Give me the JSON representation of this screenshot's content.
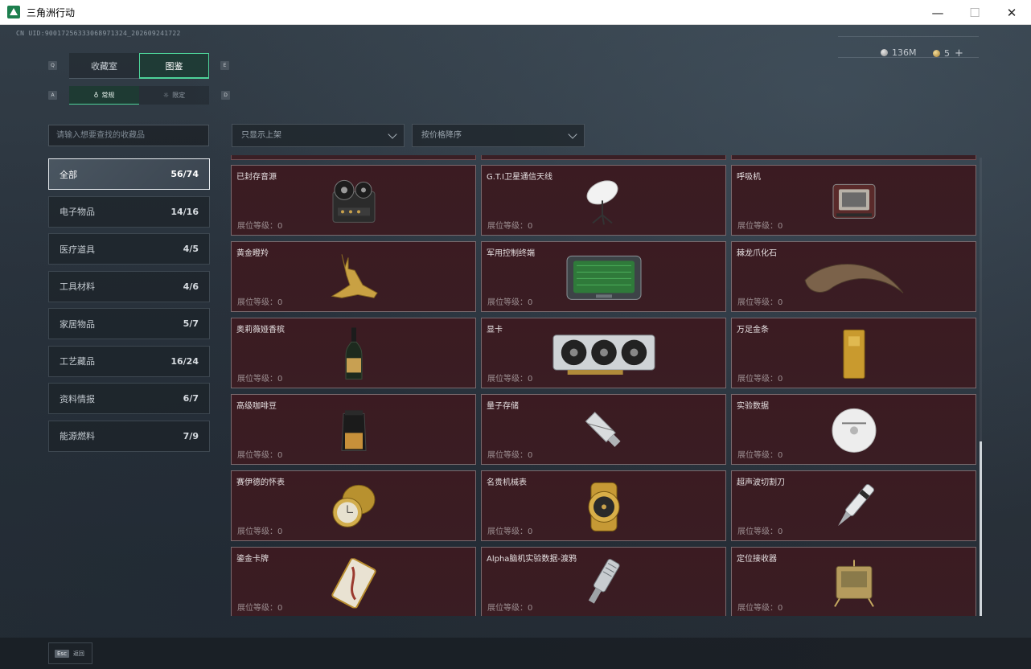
{
  "window": {
    "title": "三角洲行动",
    "minimize": "—",
    "maximize": "☐",
    "close": "✕"
  },
  "uid": "CN UID:9001725633306897132​4_2026092417​22",
  "currency": {
    "silver": "136M",
    "gold": "5",
    "plus": "+"
  },
  "keys": {
    "prev_tab": "Q",
    "next_tab": "E",
    "prev_sub": "A",
    "next_sub": "D"
  },
  "tabs": [
    {
      "label": "收藏室"
    },
    {
      "label": "图鉴"
    }
  ],
  "subtabs": [
    {
      "label": "常规"
    },
    {
      "label": "限定"
    }
  ],
  "search": {
    "placeholder": "请输入想要查找的收藏品"
  },
  "filters": {
    "shelf": "只显示上架",
    "sort": "按价格降序"
  },
  "categories": [
    {
      "label": "全部",
      "count": "56/74"
    },
    {
      "label": "电子物品",
      "count": "14/16"
    },
    {
      "label": "医疗道具",
      "count": "4/5"
    },
    {
      "label": "工具材料",
      "count": "4/6"
    },
    {
      "label": "家居物品",
      "count": "5/7"
    },
    {
      "label": "工艺藏品",
      "count": "16/24"
    },
    {
      "label": "资料情报",
      "count": "6/7"
    },
    {
      "label": "能源燃料",
      "count": "7/9"
    }
  ],
  "level_label": "展位等级：0",
  "items": [
    {
      "name": "已封存音源",
      "icon": "tape-recorder-icon"
    },
    {
      "name": "G.T.I卫星通信天线",
      "icon": "satellite-dish-icon"
    },
    {
      "name": "呼吸机",
      "icon": "ventilator-icon"
    },
    {
      "name": "黄金瞪羚",
      "icon": "golden-gazelle-icon"
    },
    {
      "name": "军用控制终端",
      "icon": "control-terminal-icon"
    },
    {
      "name": "棘龙爪化石",
      "icon": "claw-fossil-icon"
    },
    {
      "name": "奥莉薇娅香槟",
      "icon": "champagne-icon"
    },
    {
      "name": "显卡",
      "icon": "graphics-card-icon"
    },
    {
      "name": "万足金条",
      "icon": "gold-bar-icon"
    },
    {
      "name": "高级咖啡豆",
      "icon": "coffee-bag-icon"
    },
    {
      "name": "量子存储",
      "icon": "usb-drive-icon"
    },
    {
      "name": "实验数据",
      "icon": "disc-icon"
    },
    {
      "name": "赛伊德的怀表",
      "icon": "pocket-watch-icon"
    },
    {
      "name": "名贵机械表",
      "icon": "wristwatch-icon"
    },
    {
      "name": "超声波切割刀",
      "icon": "ultrasonic-cutter-icon"
    },
    {
      "name": "鎏金卡牌",
      "icon": "gilded-card-icon"
    },
    {
      "name": "Alpha脑机实验数据-渡鸦",
      "icon": "data-module-icon"
    },
    {
      "name": "定位接收器",
      "icon": "gps-receiver-icon"
    }
  ],
  "esc": {
    "key": "Esc",
    "label": "返回"
  }
}
